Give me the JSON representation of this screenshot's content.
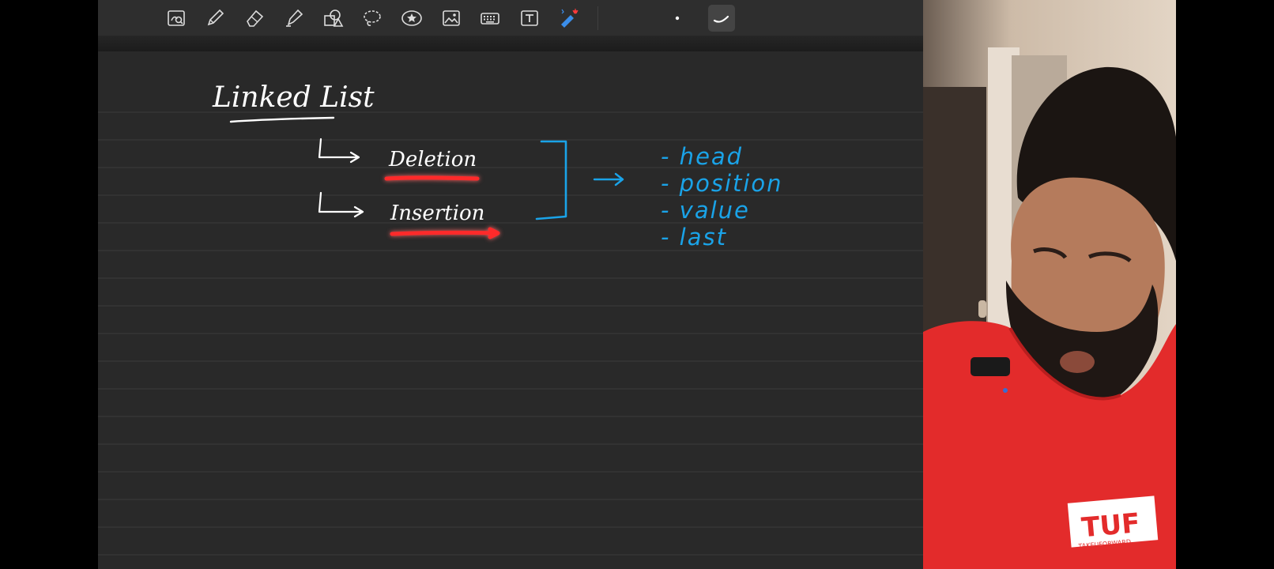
{
  "toolbar": {
    "tools": [
      {
        "name": "image-search-tool",
        "icon": "magnify-image-icon"
      },
      {
        "name": "pen-tool",
        "icon": "pen-icon"
      },
      {
        "name": "eraser-tool",
        "icon": "eraser-icon"
      },
      {
        "name": "highlighter-tool",
        "icon": "highlighter-icon"
      },
      {
        "name": "shapes-tool",
        "icon": "shapes-icon"
      },
      {
        "name": "lasso-tool",
        "icon": "lasso-icon"
      },
      {
        "name": "sticker-tool",
        "icon": "star-sticker-icon"
      },
      {
        "name": "image-tool",
        "icon": "image-icon"
      },
      {
        "name": "keyboard-tool",
        "icon": "keyboard-icon"
      },
      {
        "name": "text-tool",
        "icon": "text-box-icon"
      },
      {
        "name": "laser-pointer-tool",
        "icon": "laser-pointer-icon"
      },
      {
        "name": "stroke-dot-size",
        "icon": "dot-icon"
      },
      {
        "name": "stroke-style",
        "icon": "stroke-curve-icon"
      }
    ],
    "accent": "#3b8eea"
  },
  "notes": {
    "title": "Linked List",
    "branches": [
      "Deletion",
      "Insertion"
    ],
    "params": [
      "- head",
      "- position",
      "- value",
      "- last"
    ],
    "colors": {
      "ink": "#ffffff",
      "blue": "#1aa3e8",
      "red": "#ff2a2a"
    }
  },
  "webcam": {
    "shirt_logo": "TUF",
    "shirt_logo_sub": "TAKEUFORWARD",
    "colors": {
      "shirt": "#e32b2b",
      "wall": "#d9c9b8"
    }
  }
}
